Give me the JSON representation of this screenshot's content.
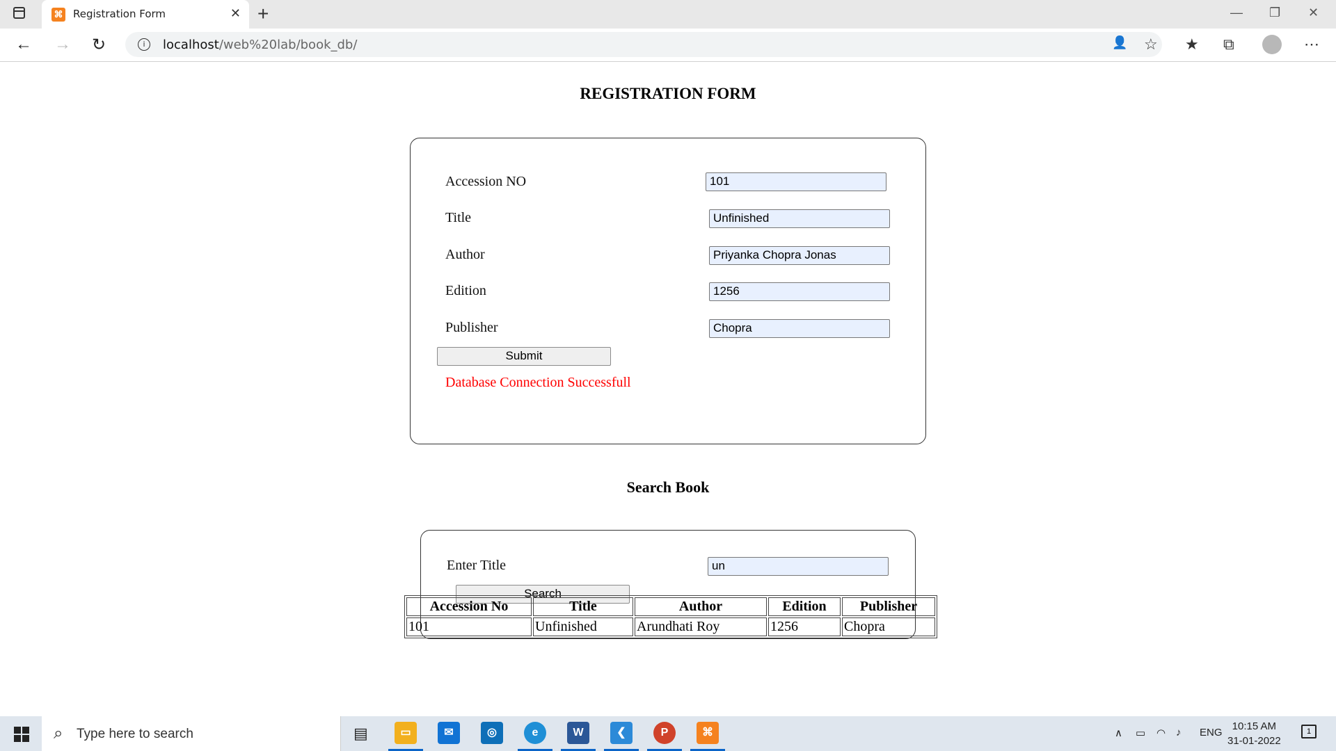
{
  "browser": {
    "tab_title": "Registration Form",
    "url_host": "localhost",
    "url_path": "/web%20lab/book_db/"
  },
  "registration": {
    "heading": "REGISTRATION FORM",
    "fields": [
      {
        "label": "Accession NO",
        "value": "101"
      },
      {
        "label": "Title",
        "value": "Unfinished"
      },
      {
        "label": "Author",
        "value": "Priyanka Chopra Jonas"
      },
      {
        "label": "Edition",
        "value": "1256"
      },
      {
        "label": "Publisher",
        "value": "Chopra"
      }
    ],
    "submit_label": "Submit",
    "status_message": "Database Connection Successfull",
    "status_color": "#ff0000"
  },
  "search": {
    "heading": "Search Book",
    "label": "Enter Title",
    "value": "un",
    "button_label": "Search"
  },
  "results": {
    "headers": [
      "Accession No",
      "Title",
      "Author",
      "Edition",
      "Publisher"
    ],
    "rows": [
      [
        "101",
        "Unfinished",
        "Arundhati Roy",
        "1256",
        "Chopra"
      ]
    ]
  },
  "taskbar": {
    "search_placeholder": "Type here to search",
    "language": "ENG",
    "time": "10:15 AM",
    "date": "31-01-2022",
    "notification_count": "1"
  }
}
